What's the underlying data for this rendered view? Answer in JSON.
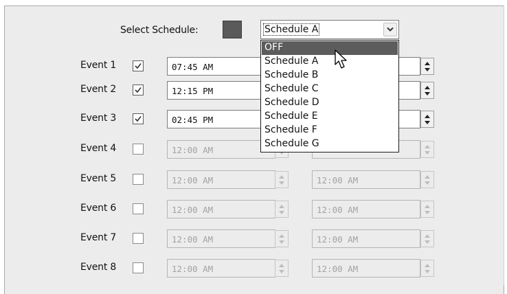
{
  "select_schedule": {
    "label": "Select Schedule:",
    "current_value": "Schedule A",
    "options": [
      "OFF",
      "Schedule A",
      "Schedule B",
      "Schedule C",
      "Schedule D",
      "Schedule E",
      "Schedule F",
      "Schedule G"
    ],
    "highlighted_option": "OFF"
  },
  "events": [
    {
      "label": "Event 1",
      "checked": true,
      "start": "07:45 AM",
      "end": "",
      "enabled": true
    },
    {
      "label": "Event 2",
      "checked": true,
      "start": "12:15 PM",
      "end": "",
      "enabled": true
    },
    {
      "label": "Event 3",
      "checked": true,
      "start": "02:45 PM",
      "end": "",
      "enabled": true
    },
    {
      "label": "Event 4",
      "checked": false,
      "start": "12:00 AM",
      "end": "",
      "enabled": false
    },
    {
      "label": "Event 5",
      "checked": false,
      "start": "12:00 AM",
      "end": "12:00 AM",
      "enabled": false
    },
    {
      "label": "Event 6",
      "checked": false,
      "start": "12:00 AM",
      "end": "12:00 AM",
      "enabled": false
    },
    {
      "label": "Event 7",
      "checked": false,
      "start": "12:00 AM",
      "end": "12:00 AM",
      "enabled": false
    },
    {
      "label": "Event 8",
      "checked": false,
      "start": "12:00 AM",
      "end": "12:00 AM",
      "enabled": false
    }
  ],
  "colors": {
    "panel_bg": "#ececec",
    "swatch": "#5a5a5a",
    "highlight": "#5c5c5c",
    "disabled_text": "#a3a3a3"
  },
  "icons": {
    "combo_arrow": "chevron-down-icon",
    "checkbox": "checkmark-icon",
    "spinner_up": "spin-up-icon",
    "spinner_down": "spin-down-icon",
    "cursor": "mouse-pointer-icon"
  }
}
